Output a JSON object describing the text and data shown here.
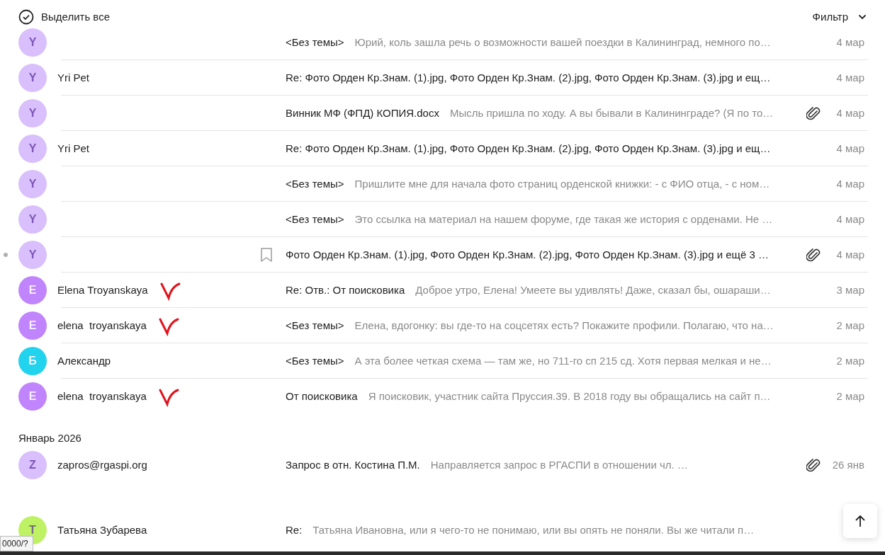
{
  "toolbar": {
    "select_all": "Выделить все",
    "filter": "Фильтр"
  },
  "groups": [
    {
      "rows": [
        {
          "avatar": {
            "letter": "Y",
            "color": "#d9bffb",
            "light": true
          },
          "subject": "<Без темы>",
          "preview": "Юрий, коль зашла речь о возможности вашей поездки в Калининград, немного по…",
          "date": "4 мар",
          "attachment": false,
          "unread": false,
          "bookmark": false,
          "annotated": false
        },
        {
          "avatar": {
            "letter": "Y",
            "color": "#d9bffb",
            "light": true
          },
          "sender": "Yri Pet",
          "subject": "Re: Фото Орден Кр.Знам. (1).jpg, Фото Орден Кр.Знам. (2).jpg, Фото Орден Кр.Знам. (3).jpg и ещ…",
          "date": "4 мар",
          "attachment": false,
          "unread": false,
          "bookmark": false,
          "annotated": false
        },
        {
          "avatar": {
            "letter": "Y",
            "color": "#d9bffb",
            "light": true
          },
          "subject": "Винник МФ (ФПД) КОПИЯ.docx",
          "preview": "Мысль пришла по ходу. А вы бывали в Калининграде? (Я по то…",
          "date": "4 мар",
          "attachment": true,
          "unread": false,
          "bookmark": false,
          "annotated": false
        },
        {
          "avatar": {
            "letter": "Y",
            "color": "#d9bffb",
            "light": true
          },
          "sender": "Yri Pet",
          "subject": "Re: Фото Орден Кр.Знам. (1).jpg, Фото Орден Кр.Знам. (2).jpg, Фото Орден Кр.Знам. (3).jpg и ещ…",
          "date": "4 мар",
          "attachment": false,
          "unread": false,
          "bookmark": false,
          "annotated": false
        },
        {
          "avatar": {
            "letter": "Y",
            "color": "#d9bffb",
            "light": true
          },
          "subject": "<Без темы>",
          "preview": "Пришлите мне для начала фото страниц орденской книжки: - с ФИО отца, - с ном…",
          "date": "4 мар",
          "attachment": false,
          "unread": false,
          "bookmark": false,
          "annotated": false
        },
        {
          "avatar": {
            "letter": "Y",
            "color": "#d9bffb",
            "light": true
          },
          "subject": "<Без темы>",
          "preview": "Это ссылка на материал на нашем форуме, где такая же история с орденами. Не …",
          "date": "4 мар",
          "attachment": false,
          "unread": false,
          "bookmark": false,
          "annotated": false
        },
        {
          "avatar": {
            "letter": "Y",
            "color": "#d9bffb",
            "light": true
          },
          "subject": "Фото Орден Кр.Знам. (1).jpg, Фото Орден Кр.Знам. (2).jpg, Фото Орден Кр.Знам. (3).jpg и ещё 3 …",
          "date": "4 мар",
          "attachment": true,
          "unread": true,
          "bookmark": true,
          "annotated": false
        },
        {
          "avatar": {
            "letter": "E",
            "color": "#c084fc",
            "light": false
          },
          "sender": "Elena Troyanskaya",
          "subject": "Re: Отв.: От поисковика",
          "preview": "Доброе утро, Елена! Умеете вы удивлять! Даже, сказал бы, ошараши…",
          "date": "3 мар",
          "attachment": false,
          "unread": false,
          "bookmark": false,
          "annotated": true
        },
        {
          "avatar": {
            "letter": "E",
            "color": "#c084fc",
            "light": false
          },
          "sender": "elena  troyanskaya",
          "subject": "<Без темы>",
          "preview": "Елена, вдогонку: вы где-то на соцсетях есть? Покажите профили. Полагаю, что на…",
          "date": "2 мар",
          "attachment": false,
          "unread": false,
          "bookmark": false,
          "annotated": true
        },
        {
          "avatar": {
            "letter": "Б",
            "color": "#22d3ee",
            "light": false
          },
          "sender": "Александр",
          "subject": "<Без темы>",
          "preview": "А эта более четкая схема — там же, но 711-го сп 215 сд. Хотя первая мелкая и не…",
          "date": "2 мар",
          "attachment": false,
          "unread": false,
          "bookmark": false,
          "annotated": false
        },
        {
          "avatar": {
            "letter": "E",
            "color": "#c084fc",
            "light": false
          },
          "sender": "elena  troyanskaya",
          "subject": "От поисковика",
          "preview": "Я поисковик, участник сайта Пруссия.39. В 2018 году вы обращались на сайт п…",
          "date": "2 мар",
          "attachment": false,
          "unread": false,
          "bookmark": false,
          "annotated": true
        }
      ]
    },
    {
      "title": "Январь 2026",
      "rows": [
        {
          "avatar": {
            "letter": "Z",
            "color": "#d9bffb",
            "light": true
          },
          "sender": "zapros@rgaspi.org",
          "subject": "Запрос в отн. Костина П.М.",
          "preview": "Направляется запрос в РГАСПИ в отношении чл. …",
          "date": "26 янв",
          "attachment": true,
          "unread": false,
          "bookmark": false,
          "annotated": false
        }
      ]
    },
    {
      "rows": [
        {
          "avatar": {
            "letter": "Т",
            "color": "#bef264",
            "light": true
          },
          "sender": "Татьяна Зубарева",
          "subject": "Re:",
          "preview": "Татьяна Ивановна, или я чего-то не понимаю, или вы опять не поняли. Вы же читали п…",
          "attachment": false,
          "unread": false,
          "bookmark": false,
          "annotated": false
        }
      ]
    }
  ],
  "status_tooltip": "0000/?"
}
